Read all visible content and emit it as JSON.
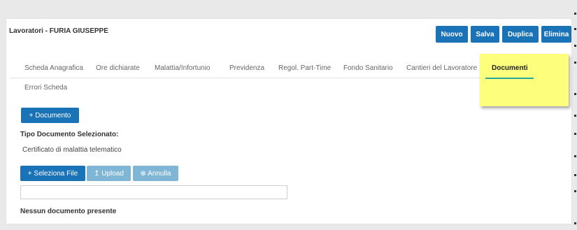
{
  "header": {
    "title": "Lavoratori - FURIA GIUSEPPE",
    "buttons": {
      "nuovo": "Nuovo",
      "salva": "Salva",
      "duplica": "Duplica",
      "elimina": "Elimina"
    }
  },
  "tabs": {
    "scheda_anagrafica": "Scheda Anagrafica",
    "ore_dichiarate": "Ore dichiarate",
    "malattia": "Malattia/Infortunio",
    "previdenza": "Previdenza",
    "regol_part_time": "Regol. Part-Time",
    "fondo_sanitario": "Fondo Sanitario",
    "cantieri": "Cantieri del Lavoratore",
    "documenti": "Documenti",
    "errori_scheda": "Errori Scheda",
    "active": "documenti"
  },
  "documents": {
    "add_button": "+ Documento",
    "selected_type_label": "Tipo Documento Selezionato:",
    "selected_type_value": "Certificato di malattia telematico",
    "select_file_button": "+ Seleziona File",
    "upload_button": "↥ Upload",
    "cancel_button": "⊗ Annulla",
    "file_input_value": "",
    "empty_message": "Nessun documento presente"
  },
  "colors": {
    "primary": "#1a73b7",
    "disabled": "#7fb6d6",
    "highlight": "#fefe7d",
    "active_underline": "#28a99c"
  }
}
